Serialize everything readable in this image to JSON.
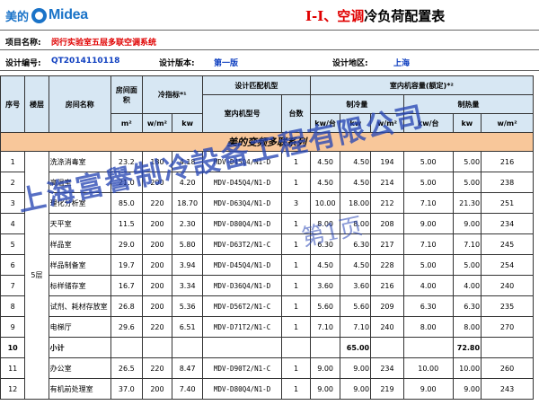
{
  "brand": {
    "cn": "美的",
    "en": "Midea"
  },
  "title": {
    "part1": "I-I、",
    "part2": "空调",
    "part3": "冷负荷配置表"
  },
  "info": {
    "project_label": "项目名称:",
    "project_value": "闵行实验室五层多联空调系统",
    "code_label": "设计编号:",
    "code_value": "QT2014110118",
    "version_label": "设计版本:",
    "version_value": "第一版",
    "region_label": "设计地区:",
    "region_value": "上海"
  },
  "headers": {
    "no": "序号",
    "floor": "楼层",
    "room": "房间名称",
    "area": "房间面积",
    "cooling_index": "冷指标*¹",
    "design_model": "设计匹配机型",
    "indoor_model": "室内机型号",
    "count": "台数",
    "capacity": "室内机容量(额定)*²",
    "cooling_cap": "制冷量",
    "heating_cap": "制热量",
    "unit_m2": "m²",
    "unit_wm2": "w/m²",
    "unit_kw": "kw",
    "unit_kw_set": "kw/台",
    "unit_w_m2": "w/m²"
  },
  "series_band": "美的变频多联系列",
  "rows": [
    {
      "no": "1",
      "room": "洗涤消毒室",
      "area": "23.2",
      "wm2": "180",
      "kw": "4.18",
      "model": "MDV-D45Q4/N1-D",
      "count": "1",
      "c1": "4.50",
      "c2": "4.50",
      "c3": "194",
      "h1": "5.00",
      "h2": "5.00",
      "h3": "216"
    },
    {
      "no": "2",
      "room": "高温室",
      "area": "21.0",
      "wm2": "200",
      "kw": "4.20",
      "model": "MDV-D45Q4/N1-D",
      "count": "1",
      "c1": "4.50",
      "c2": "4.50",
      "c3": "214",
      "h1": "5.00",
      "h2": "5.00",
      "h3": "238"
    },
    {
      "no": "3",
      "room": "理化分析室",
      "area": "85.0",
      "wm2": "220",
      "kw": "18.70",
      "model": "MDV-D63Q4/N1-D",
      "count": "3",
      "c1": "10.00",
      "c2": "18.00",
      "c3": "212",
      "h1": "7.10",
      "h2": "21.30",
      "h3": "251"
    },
    {
      "no": "4",
      "room": "天平室",
      "area": "11.5",
      "wm2": "200",
      "kw": "2.30",
      "model": "MDV-D80Q4/N1-D",
      "count": "1",
      "c1": "8.00",
      "c2": "8.00",
      "c3": "208",
      "h1": "9.00",
      "h2": "9.00",
      "h3": "234"
    },
    {
      "no": "5",
      "room": "样品室",
      "area": "29.0",
      "wm2": "200",
      "kw": "5.80",
      "model": "MDV-D63T2/N1-C",
      "count": "1",
      "c1": "6.30",
      "c2": "6.30",
      "c3": "217",
      "h1": "7.10",
      "h2": "7.10",
      "h3": "245"
    },
    {
      "no": "6",
      "room": "样品制备室",
      "area": "19.7",
      "wm2": "200",
      "kw": "3.94",
      "model": "MDV-D45Q4/N1-D",
      "count": "1",
      "c1": "4.50",
      "c2": "4.50",
      "c3": "228",
      "h1": "5.00",
      "h2": "5.00",
      "h3": "254"
    },
    {
      "no": "7",
      "room": "标样储存室",
      "area": "16.7",
      "wm2": "200",
      "kw": "3.34",
      "model": "MDV-D36Q4/N1-D",
      "count": "1",
      "c1": "3.60",
      "c2": "3.60",
      "c3": "216",
      "h1": "4.00",
      "h2": "4.00",
      "h3": "240"
    },
    {
      "no": "8",
      "room": "试剂、耗材存放室",
      "area": "26.8",
      "wm2": "200",
      "kw": "5.36",
      "model": "MDV-D56T2/N1-C",
      "count": "1",
      "c1": "5.60",
      "c2": "5.60",
      "c3": "209",
      "h1": "6.30",
      "h2": "6.30",
      "h3": "235"
    },
    {
      "no": "9",
      "room": "电梯厅",
      "area": "29.6",
      "wm2": "220",
      "kw": "6.51",
      "model": "MDV-D71T2/N1-C",
      "count": "1",
      "c1": "7.10",
      "c2": "7.10",
      "c3": "240",
      "h1": "8.00",
      "h2": "8.00",
      "h3": "270"
    },
    {
      "no": "10",
      "room": "小计",
      "area": "",
      "wm2": "",
      "kw": "",
      "model": "",
      "count": "",
      "c1": "",
      "c2": "65.00",
      "c3": "",
      "h1": "",
      "h2": "72.80",
      "h3": ""
    },
    {
      "no": "11",
      "room": "办公室",
      "area": "26.5",
      "wm2": "220",
      "kw": "8.47",
      "model": "MDV-D90T2/N1-C",
      "count": "1",
      "c1": "9.00",
      "c2": "9.00",
      "c3": "234",
      "h1": "10.00",
      "h2": "10.00",
      "h3": "260"
    },
    {
      "no": "12",
      "room": "有机前处理室",
      "area": "37.0",
      "wm2": "200",
      "kw": "7.40",
      "model": "MDV-D80Q4/N1-D",
      "count": "1",
      "c1": "9.00",
      "c2": "9.00",
      "c3": "219",
      "h1": "9.00",
      "h2": "9.00",
      "h3": "243"
    }
  ],
  "floor_label": "5层",
  "watermark": {
    "line1": "上海富譽制冷設备工程有限公司",
    "line2": "第1页"
  }
}
